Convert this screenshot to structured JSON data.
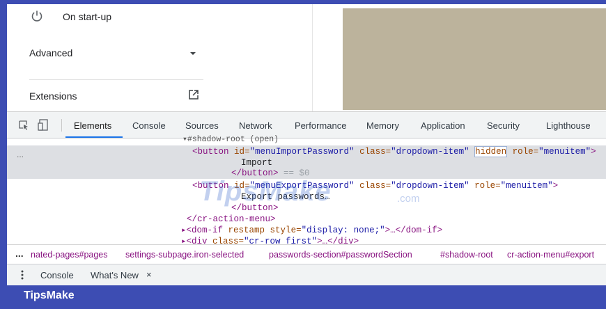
{
  "settings": {
    "startup_label": "On start-up",
    "advanced_label": "Advanced",
    "extensions_label": "Extensions"
  },
  "devtools": {
    "tabs": [
      "Elements",
      "Console",
      "Sources",
      "Network",
      "Performance",
      "Memory",
      "Application",
      "Security",
      "Lighthouse"
    ],
    "code": {
      "line0": "▾#shadow-root (open)",
      "line1_tag_open": "<button",
      "line1_attr1": " id=",
      "line1_val1": "\"menuImportPassword\"",
      "line1_attr2": " class=",
      "line1_val2": "\"dropdown-item\"",
      "line1_hidden": "hidden",
      "line1_attr3": " role=",
      "line1_val3": "\"menuitem\"",
      "line1_close": ">",
      "line2": "Import",
      "line3_tag": "</button>",
      "line3_suffix": " == $0",
      "line4_tag_open": "<button",
      "line4_attr1": " id=",
      "line4_val1": "\"menuExportPassword\"",
      "line4_attr2": " class=",
      "line4_val2": "\"dropdown-item\"",
      "line4_attr3": " role=",
      "line4_val3": "\"menuitem\"",
      "line4_close": ">",
      "line5": "Export passwords…",
      "line6": "</button>",
      "line7": "</cr-action-menu>",
      "line8_open": "▸<dom-if",
      "line8_attr": " restamp style=",
      "line8_val": "\"display: none;\"",
      "line8_rest": ">…</dom-if>",
      "line9_open": "▸<div",
      "line9_attr": " class=",
      "line9_val": "\"cr-row first\"",
      "line9_rest": ">…</div>",
      "dots": "..."
    },
    "watermark": "TipsMake",
    "watermark_sub": ".com",
    "breadcrumbs": {
      "dots": "...",
      "items": [
        "nated-pages#pages",
        "settings-subpage.iron-selected",
        "passwords-section#passwordSection",
        "#shadow-root",
        "cr-action-menu#export"
      ]
    },
    "drawer": {
      "console": "Console",
      "whats_new": "What's New",
      "close": "×"
    }
  },
  "footer": {
    "brand": "TipsMake"
  },
  "colors": {
    "frame_blue": "#3d4db3",
    "accent": "#1a73e8",
    "tag": "#881280",
    "attr": "#994500",
    "value": "#1a1aa6",
    "preview": "#bcb39c"
  },
  "icons": [
    "power-icon",
    "chevron-down-icon",
    "external-link-icon",
    "inspect-element-icon",
    "device-toolbar-icon",
    "drawer-menu-icon"
  ]
}
